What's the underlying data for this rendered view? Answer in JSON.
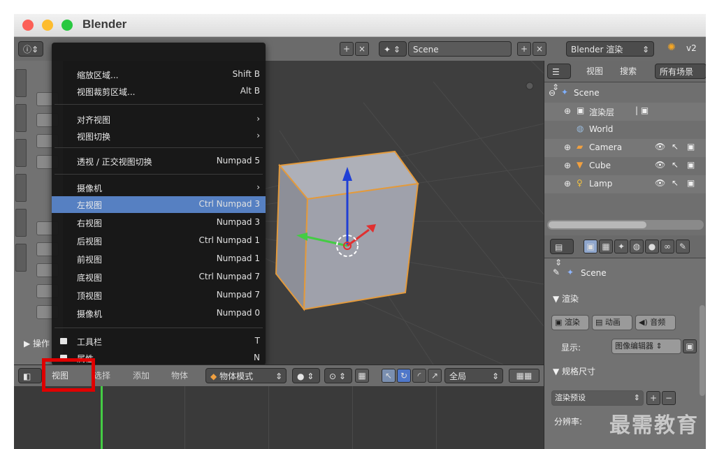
{
  "window": {
    "title": "Blender"
  },
  "info_header": {
    "scene_name": "Scene",
    "render_engine": "Blender 渲染",
    "version": "v2"
  },
  "menu": {
    "items": [
      {
        "label": "缩放区域...",
        "shortcut": "Shift B"
      },
      {
        "label": "视图裁剪区域...",
        "shortcut": "Alt B"
      },
      {
        "label": "对齐视图",
        "shortcut": "›"
      },
      {
        "label": "视图切换",
        "shortcut": "›"
      },
      {
        "label": "透视 / 正交视图切换",
        "shortcut": "Numpad 5"
      },
      {
        "label": "摄像机",
        "shortcut": "›"
      },
      {
        "label": "左视图",
        "shortcut": "Ctrl Numpad 3"
      },
      {
        "label": "右视图",
        "shortcut": "Numpad 3"
      },
      {
        "label": "后视图",
        "shortcut": "Ctrl Numpad 1"
      },
      {
        "label": "前视图",
        "shortcut": "Numpad 1"
      },
      {
        "label": "底视图",
        "shortcut": "Ctrl Numpad 7"
      },
      {
        "label": "顶视图",
        "shortcut": "Numpad 7"
      },
      {
        "label": "摄像机",
        "shortcut": "Numpad 0"
      },
      {
        "label": "工具栏",
        "shortcut": "T"
      },
      {
        "label": "属性",
        "shortcut": "N"
      }
    ]
  },
  "viewport_header": {
    "view": "视图",
    "select": "选择",
    "add": "添加",
    "object": "物体",
    "mode": "物体模式",
    "orientation": "全局"
  },
  "toolshelf": {
    "operator_label": "▶ 操作"
  },
  "outliner": {
    "view": "视图",
    "search": "搜索",
    "filter": "所有场景",
    "rows": [
      "Scene",
      "渲染层",
      "World",
      "Camera",
      "Cube",
      "Lamp"
    ]
  },
  "properties": {
    "scene": "Scene",
    "render_panel": "▼ 渲染",
    "render_btn": "渲染",
    "anim_btn": "动画",
    "audio_btn": "音频",
    "display_label": "显示:",
    "display_value": "图像编辑器",
    "dimensions_panel": "▼ 规格尺寸",
    "preset": "渲染预设",
    "resolution_label": "分辨率:"
  },
  "watermark": "最需教育",
  "colors": {
    "highlight": "#5680c2",
    "callout": "#e00000",
    "green_axis": "#44cc44",
    "blue_axis": "#1f3fd6",
    "red_axis": "#e03030"
  }
}
